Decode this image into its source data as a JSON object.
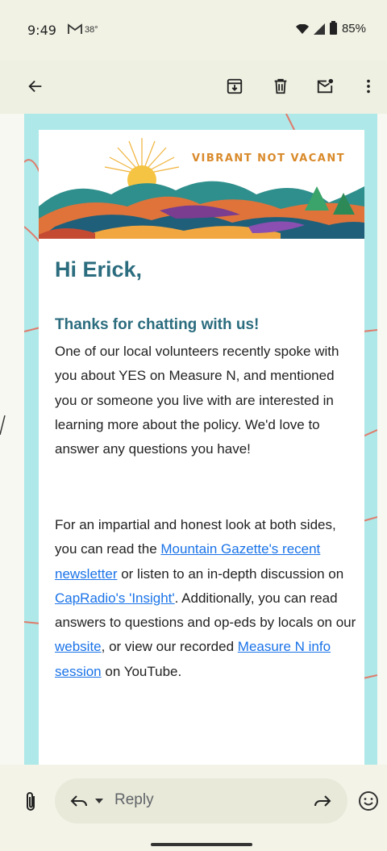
{
  "status_bar": {
    "time": "9:49",
    "temperature": "38°",
    "battery": "85%"
  },
  "toolbar": {
    "icons": [
      "back-arrow-icon",
      "archive-icon",
      "delete-icon",
      "mark-unread-icon",
      "more-vert-icon"
    ]
  },
  "email": {
    "banner_slogan": "VIBRANT NOT VACANT",
    "greeting": "Hi Erick,",
    "subheading": "Thanks for chatting with us!",
    "paragraph1": "One of our local volunteers recently spoke with you about YES on Measure N, and mentioned you or someone you live with are interested in learning more about the policy. We'd love to answer any questions you have!",
    "p2_text1": "For an impartial and honest look at both sides, you can read the ",
    "p2_link1": "Mountain Gazette's recent newsletter",
    "p2_text2": " or listen to an in-depth discussion on ",
    "p2_link2": "CapRadio's 'Insight'",
    "p2_text3": ". Additionally, you can read answers to questions and op-eds by locals on our ",
    "p2_link3": "website",
    "p2_text4": ", or view our recorded ",
    "p2_link4": "Measure N info session",
    "p2_text5": " on YouTube."
  },
  "reply_bar": {
    "reply_label": "Reply"
  },
  "colors": {
    "heading": "#2b6c7e",
    "link": "#1a73e8",
    "frame": "#aee8e8",
    "slogan": "#d98a2b"
  }
}
